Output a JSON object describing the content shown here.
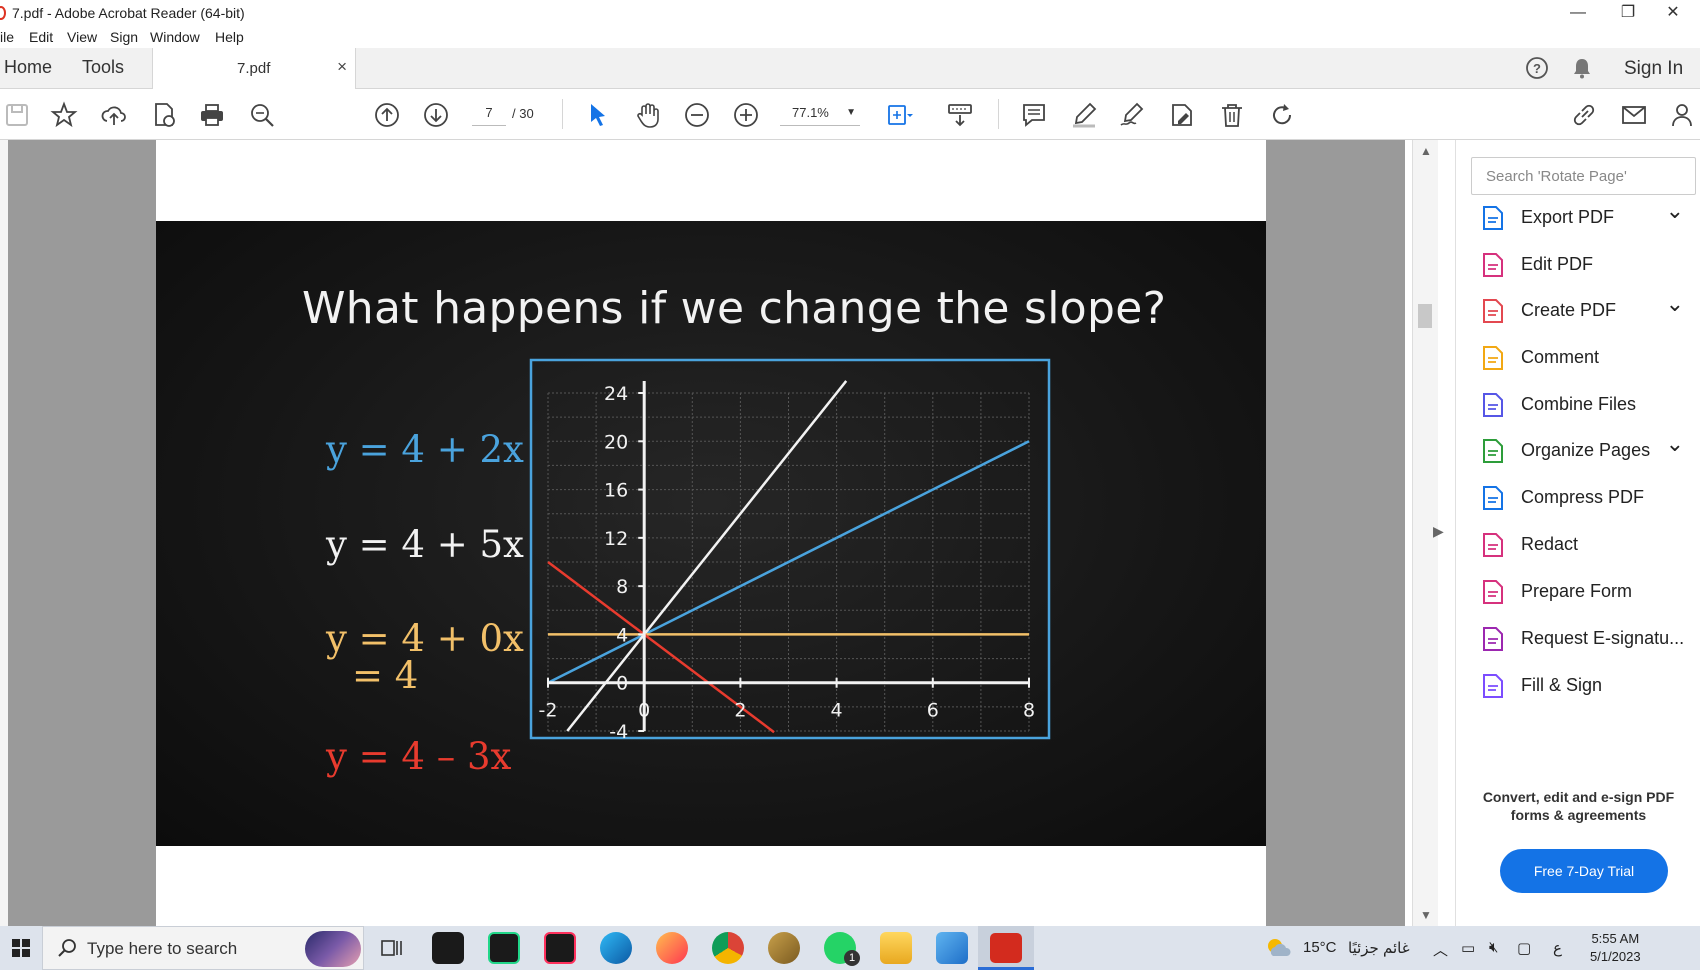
{
  "window": {
    "title": "7.pdf - Adobe Acrobat Reader (64-bit)",
    "controls": {
      "minimize": "—",
      "maximize": "❐",
      "close": "✕"
    }
  },
  "menu": [
    "ile",
    "Edit",
    "View",
    "Sign",
    "Window",
    "Help"
  ],
  "tabs": {
    "home": "Home",
    "tools": "Tools",
    "document": "7.pdf",
    "close": "×",
    "sign_in": "Sign In"
  },
  "toolbar": {
    "page_current": "7",
    "page_total": "/ 30",
    "zoom": "77.1%"
  },
  "slide": {
    "title": "What happens if we change the slope?",
    "equations": [
      {
        "text": "y = 4 + 2x",
        "color": "#4aa3dd"
      },
      {
        "text": "y = 4 + 5x",
        "color": "#f2f2f2"
      },
      {
        "text": "y = 4 + 0x",
        "color": "#f2c069"
      },
      {
        "text": "= 4",
        "color": "#f2c069"
      },
      {
        "text": "y = 4 – 3x",
        "color": "#e83b2e"
      }
    ]
  },
  "chart_data": {
    "type": "line",
    "x_ticks": [
      "-2",
      "0",
      "2",
      "4",
      "6",
      "8"
    ],
    "y_ticks": [
      "24",
      "20",
      "16",
      "12",
      "8",
      "4",
      "0",
      "-4"
    ],
    "xlim": [
      -2,
      8
    ],
    "ylim": [
      -4,
      24
    ],
    "grid": true,
    "series": [
      {
        "color": "#4aa3dd",
        "x": [
          -2,
          8
        ],
        "y": [
          0,
          20
        ]
      },
      {
        "color": "#f2f2f2",
        "x": [
          -1.6,
          4.2
        ],
        "y": [
          -4,
          25
        ]
      },
      {
        "color": "#f2c069",
        "x": [
          -2,
          8
        ],
        "y": [
          4,
          4
        ]
      },
      {
        "color": "#e83b2e",
        "x": [
          -2,
          2.7
        ],
        "y": [
          10,
          -4.1
        ]
      }
    ]
  },
  "right_panel": {
    "search_placeholder": "Search 'Rotate Page'",
    "tools": [
      {
        "label": "Export PDF",
        "icon": "export-pdf-icon",
        "color": "#1473e6",
        "expand": true
      },
      {
        "label": "Edit PDF",
        "icon": "edit-pdf-icon",
        "color": "#d6317d",
        "expand": false
      },
      {
        "label": "Create PDF",
        "icon": "create-pdf-icon",
        "color": "#e34850",
        "expand": true
      },
      {
        "label": "Comment",
        "icon": "comment-icon",
        "color": "#f2a813",
        "expand": false
      },
      {
        "label": "Combine Files",
        "icon": "combine-files-icon",
        "color": "#5656e6",
        "expand": false
      },
      {
        "label": "Organize Pages",
        "icon": "organize-pages-icon",
        "color": "#2d9d3a",
        "expand": true
      },
      {
        "label": "Compress PDF",
        "icon": "compress-pdf-icon",
        "color": "#1473e6",
        "expand": false
      },
      {
        "label": "Redact",
        "icon": "redact-icon",
        "color": "#d6317d",
        "expand": false
      },
      {
        "label": "Prepare Form",
        "icon": "prepare-form-icon",
        "color": "#d6317d",
        "expand": false
      },
      {
        "label": "Request E-signatu...",
        "icon": "request-esign-icon",
        "color": "#9c27b0",
        "expand": false
      },
      {
        "label": "Fill & Sign",
        "icon": "fill-sign-icon",
        "color": "#7c4dff",
        "expand": false
      }
    ],
    "promo_line1": "Convert, edit and e-sign PDF",
    "promo_line2": "forms & agreements",
    "trial_button": "Free 7-Day Trial"
  },
  "taskbar": {
    "search_placeholder": "Type here to search",
    "temperature": "15°C",
    "weather": "غائم جزئيًا",
    "lang": "ع",
    "time": "5:55 AM",
    "date": "5/1/2023",
    "whatsapp_badge": "1"
  }
}
